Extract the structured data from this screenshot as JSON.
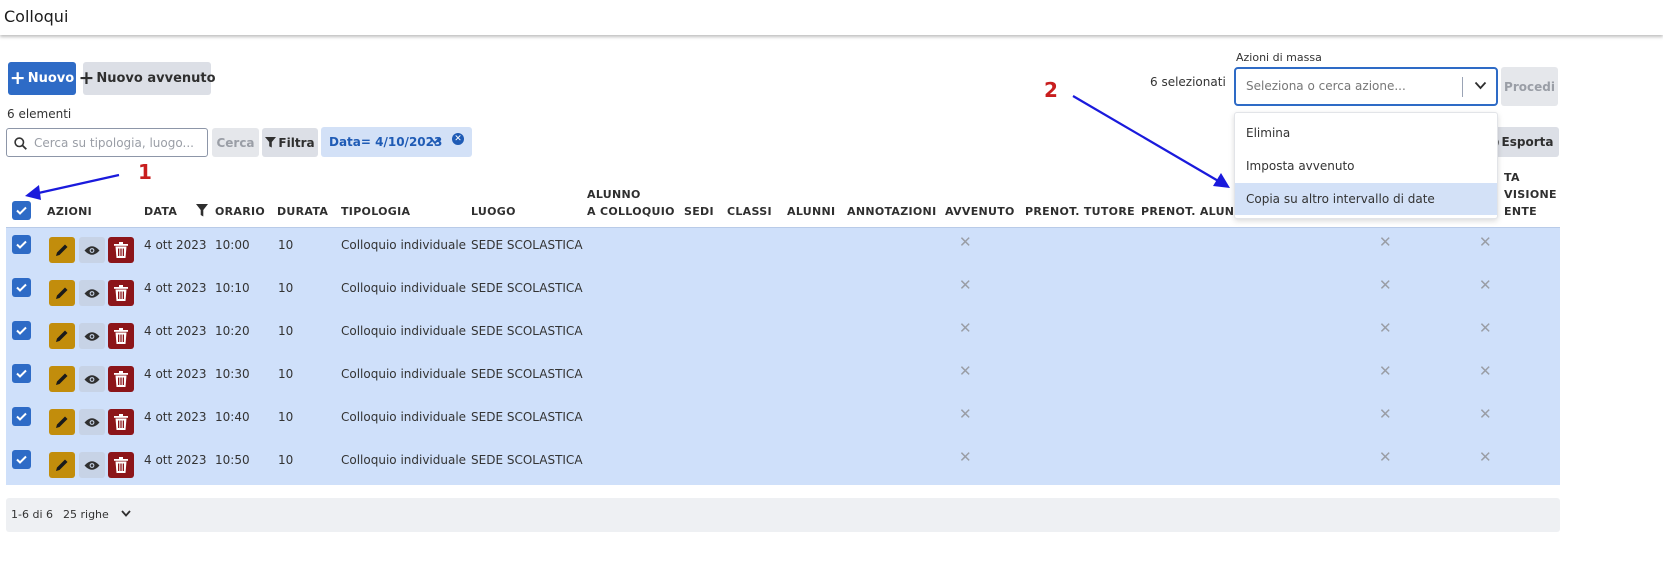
{
  "page_title": "Colloqui",
  "toolbar": {
    "new_label": "Nuovo",
    "new_held_label": "Nuovo avvenuto"
  },
  "element_count": "6 elementi",
  "search": {
    "placeholder": "Cerca su tipologia, luogo...",
    "button": "Cerca"
  },
  "filter_label": "Filtra",
  "active_filter": "Data= 4/10/2023",
  "mass_actions": {
    "label": "Azioni di massa",
    "selected_count": "6 selezionati",
    "placeholder": "Seleziona o cerca azione...",
    "proceed": "Procedi",
    "options": [
      "Elimina",
      "Imposta avvenuto",
      "Copia su altro intervallo di date"
    ],
    "highlighted": "Copia su altro intervallo di date"
  },
  "export_label": "Esporta",
  "columns": {
    "azioni": "AZIONI",
    "data": "DATA",
    "orario": "ORARIO",
    "durata": "DURATA",
    "tipologia": "TIPOLOGIA",
    "luogo": "LUOGO",
    "alunno_1": "ALUNNO",
    "alunno_2": "A COLLOQUIO",
    "sedi": "SEDI",
    "classi": "CLASSI",
    "alunni": "ALUNNI",
    "annotazioni": "ANNOTAZIONI",
    "avvenuto": "AVVENUTO",
    "prenot_tutore": "PRENOT. TUTORE",
    "prenot_alunno": "PRENOT. ALUNNO",
    "last_1": "TA",
    "last_2": "VISIONE",
    "last_3": "ENTE"
  },
  "rows": [
    {
      "date": "4 ott 2023",
      "time": "10:00",
      "duration": "10",
      "type": "Colloquio individuale",
      "place": "SEDE SCOLASTICA"
    },
    {
      "date": "4 ott 2023",
      "time": "10:10",
      "duration": "10",
      "type": "Colloquio individuale",
      "place": "SEDE SCOLASTICA"
    },
    {
      "date": "4 ott 2023",
      "time": "10:20",
      "duration": "10",
      "type": "Colloquio individuale",
      "place": "SEDE SCOLASTICA"
    },
    {
      "date": "4 ott 2023",
      "time": "10:30",
      "duration": "10",
      "type": "Colloquio individuale",
      "place": "SEDE SCOLASTICA"
    },
    {
      "date": "4 ott 2023",
      "time": "10:40",
      "duration": "10",
      "type": "Colloquio individuale",
      "place": "SEDE SCOLASTICA"
    },
    {
      "date": "4 ott 2023",
      "time": "10:50",
      "duration": "10",
      "type": "Colloquio individuale",
      "place": "SEDE SCOLASTICA"
    }
  ],
  "pagination": {
    "range": "1-6 di 6",
    "rows_per_page": "25 righe"
  },
  "annotations": {
    "marker_1": "1",
    "marker_2": "2"
  },
  "colors": {
    "primary": "#2e6bc6",
    "selected_row": "#cfe0fa",
    "edit": "#c28d0c",
    "delete": "#8c1519",
    "annotation_arrow": "#1a1adc",
    "annotation_number": "#c81e1e"
  }
}
